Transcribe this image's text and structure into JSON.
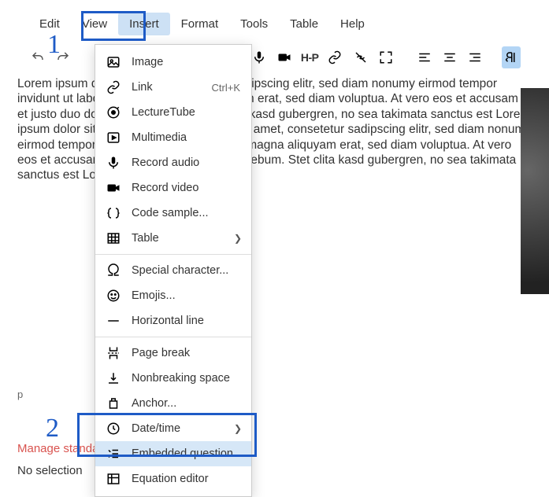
{
  "menubar": {
    "items": [
      {
        "label": "Edit"
      },
      {
        "label": "View"
      },
      {
        "label": "Insert"
      },
      {
        "label": "Format"
      },
      {
        "label": "Tools"
      },
      {
        "label": "Table"
      },
      {
        "label": "Help"
      }
    ]
  },
  "toolbar": {
    "undo": "↶",
    "redo": "↷",
    "h5p": "H-P"
  },
  "dropdown": {
    "image": "Image",
    "link": "Link",
    "link_shortcut": "Ctrl+K",
    "lecturetube": "LectureTube",
    "multimedia": "Multimedia",
    "record_audio": "Record audio",
    "record_video": "Record video",
    "code_sample": "Code sample...",
    "table": "Table",
    "special_char": "Special character...",
    "emojis": "Emojis...",
    "horizontal_line": "Horizontal line",
    "page_break": "Page break",
    "nonbreaking_space": "Nonbreaking space",
    "anchor": "Anchor...",
    "datetime": "Date/time",
    "embedded_question": "Embedded question",
    "equation_editor": "Equation editor"
  },
  "annotations": {
    "one": "1",
    "two": "2"
  },
  "content": {
    "body": "Lorem ipsum dolor sit amet, consetetur sadipscing elitr, sed diam nonumy eirmod tempor invidunt ut labore et dolore magna aliquyam erat, sed diam voluptua. At vero eos et accusam et justo duo dolores et ea rebum. Stet clita kasd gubergren, no sea takimata sanctus est Lorem ipsum dolor sit amet. Lorem ipsum dolor sit amet, consetetur sadipscing elitr, sed diam nonumy eirmod tempor invidunt ut labore et dolore magna aliquyam erat, sed diam voluptua. At vero eos et accusam et justo duo dolores et ea rebum. Stet clita kasd gubergren, no sea takimata sanctus est Lorem ipsum dolor sit amet."
  },
  "status": {
    "path": "p",
    "manage_tags": "Manage standard tags",
    "no_selection": "No selection"
  }
}
